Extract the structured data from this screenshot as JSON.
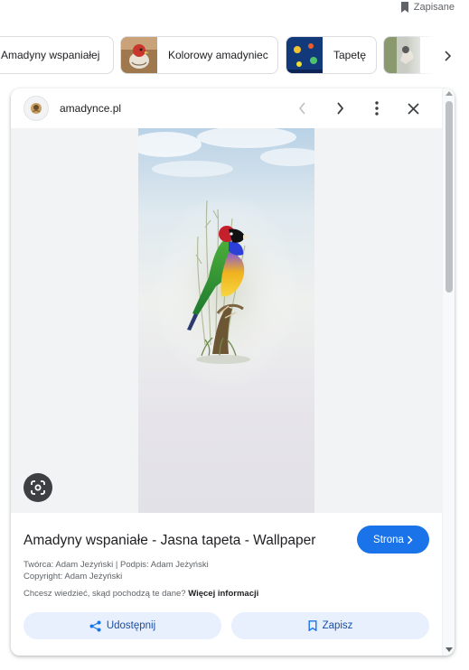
{
  "header": {
    "saved_label": "Zapisane",
    "saved_icon": "bookmark-icon"
  },
  "chips": [
    {
      "label": "Amadyny wspaniałej",
      "thumb": ""
    },
    {
      "label": "Kolorowy amadyniec",
      "thumb": "bird-photo"
    },
    {
      "label": "Tapetę",
      "thumb": "wallpaper-photo"
    },
    {
      "label": "",
      "thumb": "bird-photo"
    }
  ],
  "chips_next_icon": "chevron-right-icon",
  "preview": {
    "source_name": "amadynce.pl",
    "source_icon": "site-favicon",
    "title": "Amadyny wspaniałe - Jasna tapeta - Wallpaper",
    "visit_label": "Strona",
    "credits": "Twórca: Adam Jeżyński | Podpis: Adam Jeżyński",
    "copyright": "Copyright: Adam Jeżyński",
    "more_info_prompt": "Chcesz wiedzieć, skąd pochodzą te dane?",
    "more_info_link": "Więcej informacji",
    "share_label": "Udostępnij",
    "save_label": "Zapisz"
  },
  "colors": {
    "accent": "#1a73e8",
    "action_bg": "#e8f0fe",
    "action_text": "#174ea6",
    "image_bg": "#f1f3f4"
  }
}
